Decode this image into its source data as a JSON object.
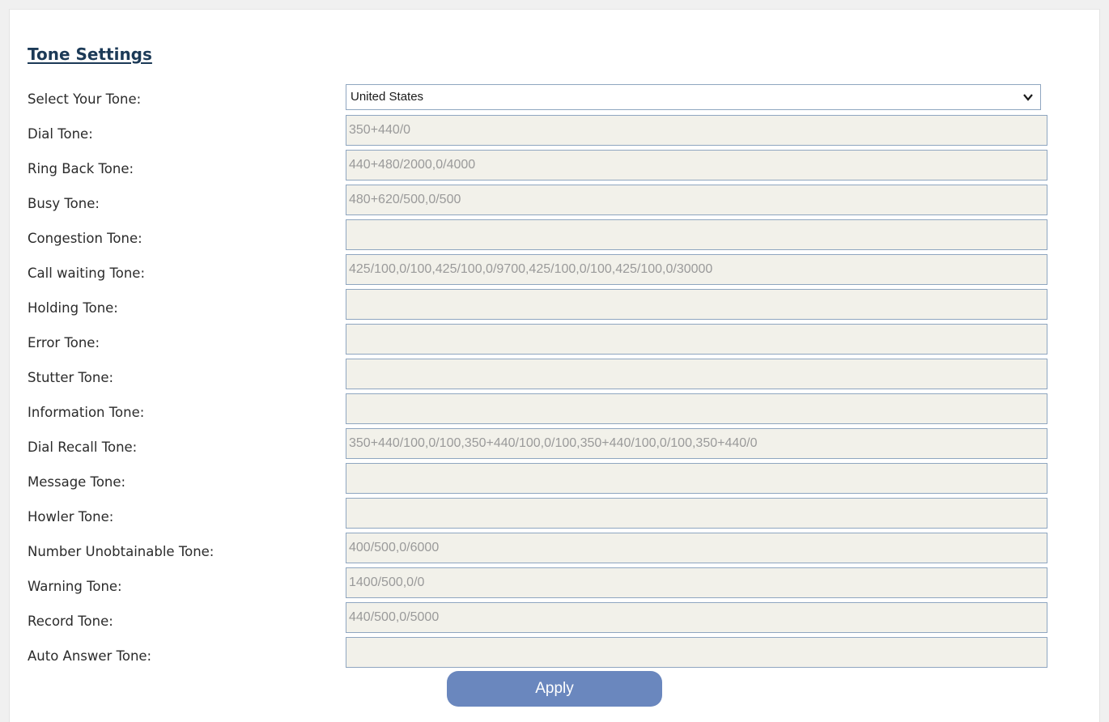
{
  "section": {
    "title": "Tone Settings"
  },
  "select": {
    "label": "Select Your Tone:",
    "value": "United States"
  },
  "tones": [
    {
      "label": "Dial Tone:",
      "value": "350+440/0"
    },
    {
      "label": "Ring Back Tone:",
      "value": "440+480/2000,0/4000"
    },
    {
      "label": "Busy Tone:",
      "value": "480+620/500,0/500"
    },
    {
      "label": "Congestion Tone:",
      "value": ""
    },
    {
      "label": "Call waiting Tone:",
      "value": "425/100,0/100,425/100,0/9700,425/100,0/100,425/100,0/30000"
    },
    {
      "label": "Holding Tone:",
      "value": ""
    },
    {
      "label": "Error Tone:",
      "value": ""
    },
    {
      "label": "Stutter Tone:",
      "value": ""
    },
    {
      "label": "Information Tone:",
      "value": ""
    },
    {
      "label": "Dial Recall Tone:",
      "value": "350+440/100,0/100,350+440/100,0/100,350+440/100,0/100,350+440/0"
    },
    {
      "label": "Message Tone:",
      "value": ""
    },
    {
      "label": "Howler Tone:",
      "value": ""
    },
    {
      "label": "Number Unobtainable Tone:",
      "value": "400/500,0/6000"
    },
    {
      "label": "Warning Tone:",
      "value": "1400/500,0/0"
    },
    {
      "label": "Record Tone:",
      "value": "440/500,0/5000"
    },
    {
      "label": "Auto Answer Tone:",
      "value": ""
    }
  ],
  "apply_button": {
    "label": "Apply"
  }
}
